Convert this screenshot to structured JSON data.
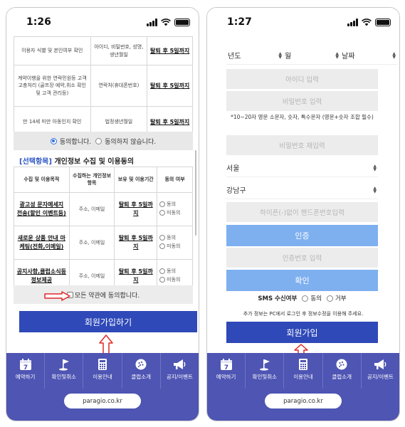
{
  "colors": {
    "accent": "#2f49b8",
    "nav_bg": "#4e55b3",
    "light_button": "#7eb0f0",
    "arrow": "#e02828",
    "link_blue": "#2f56c6"
  },
  "left": {
    "time": "1:26",
    "required_table": [
      {
        "purpose": "이용자 식별 및 본인여부 확인",
        "items": "아이디, 비밀번호, 성명, 생년월일",
        "period": "탈퇴 후 5일까지"
      },
      {
        "purpose": "계약이행을 위한 연락민원등 고객 고충처리 (골프장 예약,취소 확인 및 고객 관리등)",
        "items": "연락처(휴대폰번호)",
        "period": "탈퇴 후 5일까지"
      },
      {
        "purpose": "만 14세 미만 아동인지 확인",
        "items": "법정생년월일",
        "period": "탈퇴 후 5일까지"
      }
    ],
    "agree_label": "동의합니다.",
    "disagree_label": "동의하지 않습니다.",
    "section_tag": "[선택항목]",
    "section_title": "개인정보 수집 및 이용동의",
    "optional_headers": [
      "수집 및 이용목적",
      "수집하는 개인정보 항목",
      "보유 및 이용기간",
      "동의 여부"
    ],
    "optional_rows": [
      {
        "purpose": "광고성 문자메세지 전송(할인 이벤트등)",
        "items": "주소, 이메일",
        "period": "탈퇴 후 5일까지",
        "agree": "동의",
        "disagree": "미동의"
      },
      {
        "purpose": "새로운 상품 안내 마케팅(전화,이메일)",
        "items": "주소, 이메일",
        "period": "탈퇴 후 5일까지",
        "agree": "동의",
        "disagree": "미동의"
      },
      {
        "purpose": "공지사항,클럽소식등 정보제공",
        "items": "주소, 이메일",
        "period": "탈퇴 후 5일까지",
        "agree": "동의",
        "disagree": "미동의"
      }
    ],
    "all_agree_label": "모든 약관에 동의합니다.",
    "join_label": "회원가입하기"
  },
  "right": {
    "time": "1:27",
    "year_label": "년도",
    "month_label": "월",
    "day_label": "날짜",
    "id_placeholder": "아이디 입력",
    "pw_placeholder": "비밀번호 입력",
    "pw_note": "*10~20자 영문 소문자, 숫자, 특수문자 (영문+숫자 조합 필수)",
    "pw_confirm_placeholder": "비밀번호 재입력",
    "city_value": "서울",
    "district_value": "강남구",
    "phone_placeholder": "하이픈(-)없이 핸드폰번호입력",
    "verify_button": "인증",
    "code_placeholder": "인증번호 입력",
    "confirm_button": "확인",
    "sms_label": "SMS 수신여부",
    "sms_agree": "동의",
    "sms_reject": "거부",
    "extra_note": "추가 정보는 PC에서 로그인 후 정보수정을 이용해 주세요.",
    "join_label": "회원가입"
  },
  "nav": {
    "items": [
      {
        "label": "예약하기",
        "icon": "calendar-icon"
      },
      {
        "label": "확인및취소",
        "icon": "golf-flag-icon"
      },
      {
        "label": "이용안내",
        "icon": "calculator-icon"
      },
      {
        "label": "클럽소개",
        "icon": "golf-ball-icon"
      },
      {
        "label": "공지/이벤트",
        "icon": "megaphone-icon"
      }
    ],
    "calendar_day": "7",
    "url": "paragio.co.kr"
  }
}
